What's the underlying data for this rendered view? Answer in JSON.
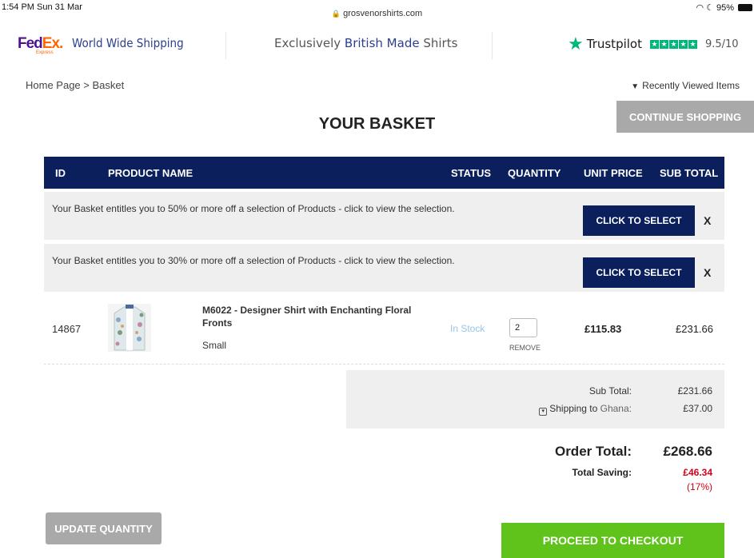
{
  "status_bar": {
    "time": "1:54 PM  Sun 31 Mar",
    "url": "grosvenorshirts.com",
    "battery": "95%"
  },
  "top_strip": {
    "fedex_fed": "Fed",
    "fedex_ex": "Ex.",
    "fedex_sub": "Express",
    "shipping": "World Wide Shipping",
    "exclusive_prefix": "Exclusively ",
    "exclusive_brit": "British Made",
    "exclusive_suffix": " Shirts",
    "trustpilot": "Trustpilot",
    "trust_score": "9.5/10"
  },
  "breadcrumb": "Home Page > Basket",
  "recently_viewed": "Recently Viewed Items",
  "page_title": "YOUR BASKET",
  "continue_shopping": "CONTINUE SHOPPING",
  "table_headers": [
    "ID",
    "PRODUCT NAME",
    "STATUS",
    "QUANTITY",
    "UNIT PRICE",
    "SUB TOTAL"
  ],
  "promos": [
    {
      "text": "Your Basket entitles you to 50% or more off a selection of Products - click to view the selection.",
      "button": "CLICK TO SELECT",
      "close": "X"
    },
    {
      "text": "Your Basket entitles you to 30% or more off a selection of Products - click to view the selection.",
      "button": "CLICK TO SELECT",
      "close": "X"
    }
  ],
  "item": {
    "id": "14867",
    "name": "M6022 - Designer Shirt with Enchanting Floral Fronts",
    "size": "Small",
    "status": "In Stock",
    "quantity": "2",
    "remove": "REMOVE",
    "unit_price": "£115.83",
    "sub_total": "£231.66"
  },
  "totals": {
    "sub_total_label": "Sub Total:",
    "sub_total_value": "£231.66",
    "shipping_label": "Shipping to",
    "shipping_country": "Ghana:",
    "shipping_value": "£37.00",
    "order_total_label": "Order Total:",
    "order_total_value": "£268.66",
    "total_saving_label": "Total Saving:",
    "total_saving_value": "£46.34",
    "total_saving_pct": "(17%)"
  },
  "buttons": {
    "update_quantity": "UPDATE QUANTITY",
    "checkout": "PROCEED TO CHECKOUT"
  },
  "colors": {
    "navy": "#0a1f5c",
    "checkout_green": "#5fc31b",
    "saving_red": "#d0021b",
    "trustpilot_green": "#00b67a"
  }
}
